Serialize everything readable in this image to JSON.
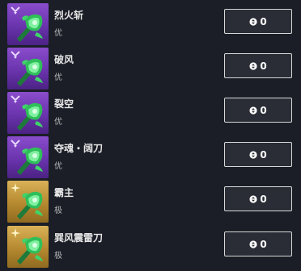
{
  "items": [
    {
      "name": "烈火斩",
      "grade": "优",
      "quantity": "0",
      "tier_color": "purple",
      "tier_icon": "chevron-down-icon"
    },
    {
      "name": "破风",
      "grade": "优",
      "quantity": "0",
      "tier_color": "purple",
      "tier_icon": "chevron-down-icon"
    },
    {
      "name": "裂空",
      "grade": "优",
      "quantity": "0",
      "tier_color": "purple",
      "tier_icon": "chevron-down-icon"
    },
    {
      "name": "夺魂・阔刀",
      "grade": "优",
      "quantity": "0",
      "tier_color": "purple",
      "tier_icon": "chevron-down-icon"
    },
    {
      "name": "霸主",
      "grade": "极",
      "quantity": "0",
      "tier_color": "gold",
      "tier_icon": "four-point-star-icon"
    },
    {
      "name": "巽风震雷刀",
      "grade": "极",
      "quantity": "0",
      "tier_color": "gold",
      "tier_icon": "four-point-star-icon"
    }
  ],
  "colors": {
    "background": "#1b1e27",
    "purple_tier": "#7b42bf",
    "gold_tier": "#c79a3e",
    "button_border": "#d9d9d9",
    "item_art_green": "#2fbf5a"
  }
}
